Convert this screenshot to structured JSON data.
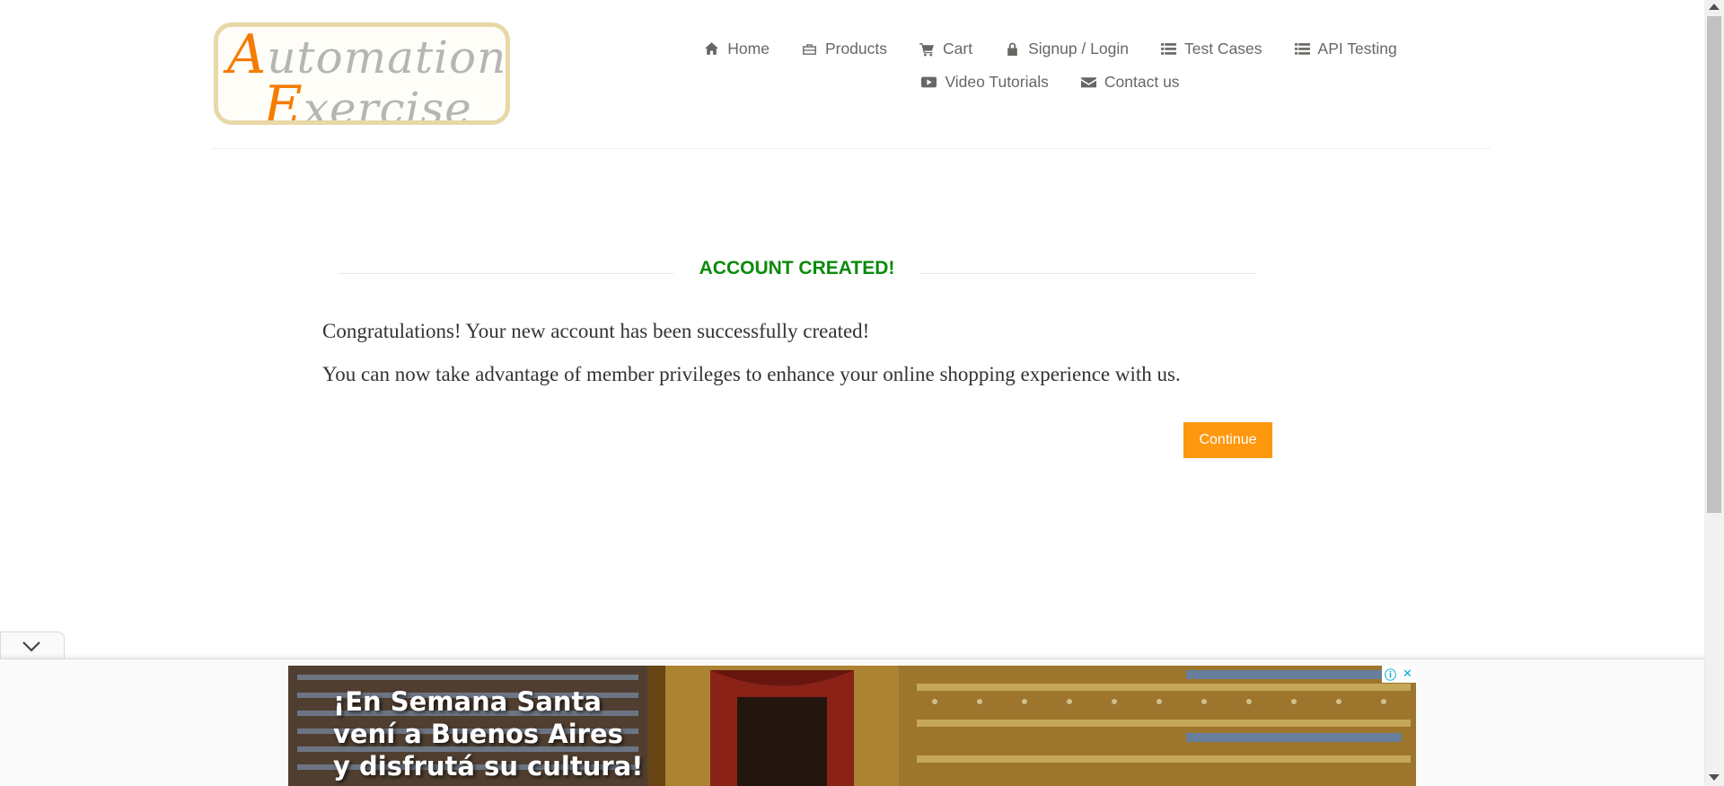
{
  "logo": {
    "line1_initial": "A",
    "line1_rest": "utomation",
    "line2_initial": "E",
    "line2_rest": "xercise"
  },
  "nav": {
    "row1": [
      {
        "label": "Home",
        "icon": "home-icon"
      },
      {
        "label": "Products",
        "icon": "briefcase-icon"
      },
      {
        "label": "Cart",
        "icon": "cart-icon"
      },
      {
        "label": "Signup / Login",
        "icon": "lock-icon"
      },
      {
        "label": "Test Cases",
        "icon": "list-icon"
      },
      {
        "label": "API Testing",
        "icon": "list-icon"
      }
    ],
    "row2": [
      {
        "label": "Video Tutorials",
        "icon": "youtube-icon"
      },
      {
        "label": "Contact us",
        "icon": "envelope-icon"
      }
    ]
  },
  "main": {
    "title": "ACCOUNT CREATED!",
    "message1": "Congratulations! Your new account has been successfully created!",
    "message2": "You can now take advantage of member privileges to enhance your online shopping experience with us.",
    "continue_label": "Continue"
  },
  "ad": {
    "line1": "¡En Semana Santa",
    "line2": "vení a Buenos Aires",
    "line3": "y disfrutá su cultura!",
    "info_icon": "ⓘ",
    "close_icon": "✕"
  },
  "colors": {
    "title": "#0b8a0b",
    "button": "#fe980f",
    "text": "#696763"
  }
}
